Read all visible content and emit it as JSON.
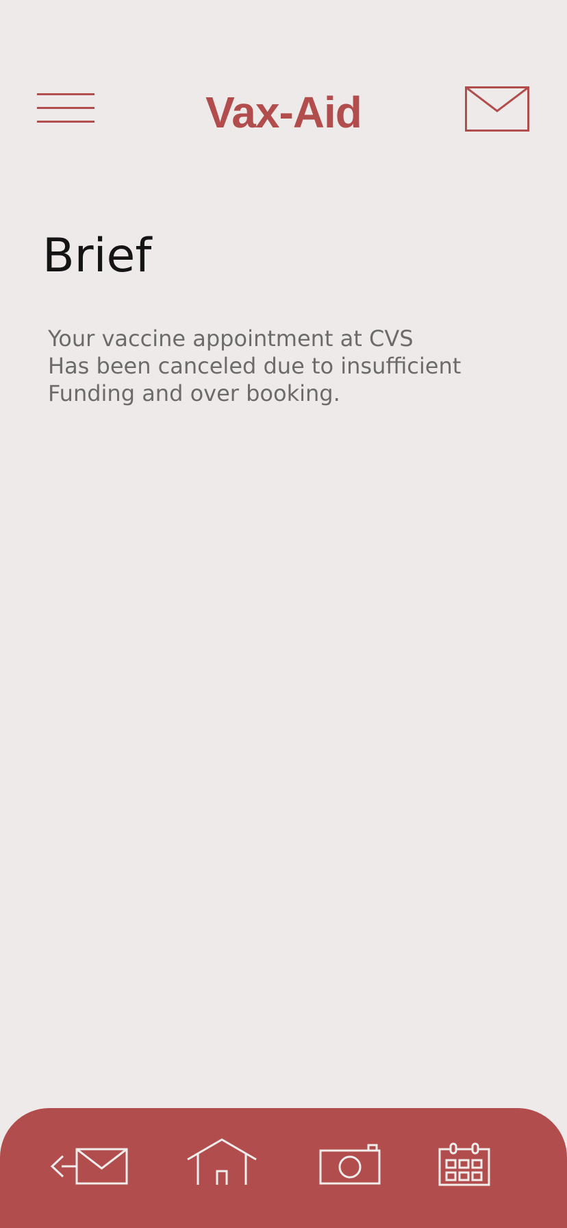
{
  "header": {
    "title": "Vax-Aid",
    "menu_icon": "hamburger-menu-icon",
    "mail_icon": "mail-icon"
  },
  "main": {
    "heading": "Brief",
    "message_lines": [
      "Your vaccine appointment at CVS",
      "Has been canceled due to insufficient",
      "Funding and over booking."
    ]
  },
  "bottom_nav": {
    "items": [
      {
        "icon": "send-mail-icon"
      },
      {
        "icon": "home-icon"
      },
      {
        "icon": "camera-icon"
      },
      {
        "icon": "calendar-icon"
      }
    ]
  },
  "colors": {
    "background": "#eeeae9",
    "accent": "#b24d4d",
    "heading_text": "#141414",
    "body_text": "#6d6a6a",
    "nav_icon": "#f2eded"
  }
}
